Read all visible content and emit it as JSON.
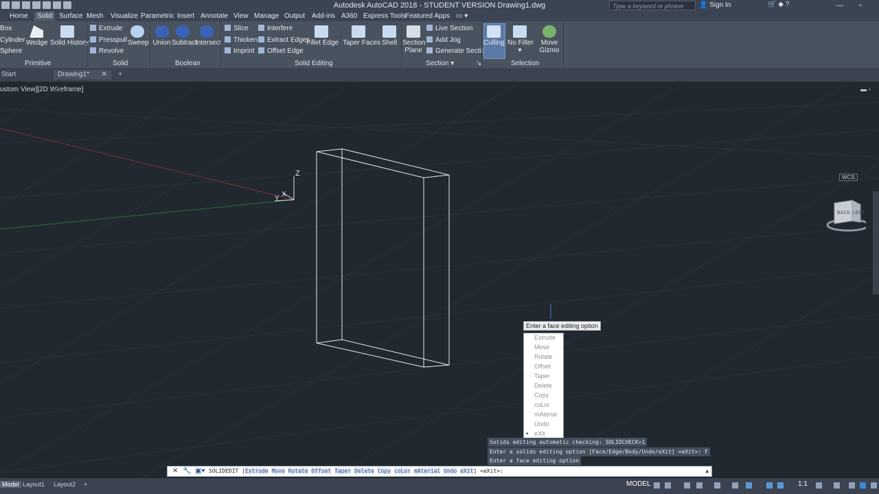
{
  "titlebar": {
    "title": "Autodesk AutoCAD 2018 - STUDENT VERSION    Drawing1.dwg",
    "search_placeholder": "Type a keyword or phrase",
    "signin": "Sign In"
  },
  "ribbon_tabs": [
    "Home",
    "Solid",
    "Surface",
    "Mesh",
    "Visualize",
    "Parametric",
    "Insert",
    "Annotate",
    "View",
    "Manage",
    "Output",
    "Add-ins",
    "A360",
    "Express Tools",
    "Featured Apps"
  ],
  "active_tab": "Solid",
  "ribbon": {
    "primitive": {
      "label": "Primitive",
      "small": [
        "Box",
        "Cylinder",
        "Sphere"
      ],
      "wedge": "Wedge",
      "solid_history": "Solid History"
    },
    "solid": {
      "label": "Solid",
      "small": [
        "Extrude",
        "Presspull",
        "Revolve"
      ],
      "sweep": "Sweep"
    },
    "boolean": {
      "label": "Boolean",
      "buttons": [
        "Union",
        "Subtract",
        "Intersect"
      ]
    },
    "solid_editing": {
      "label": "Solid Editing",
      "col1": [
        "Slice",
        "Thicken",
        "Imprint"
      ],
      "col2": [
        "Interfere",
        "Extract Edges",
        "Offset Edge"
      ],
      "fillet_edge": "Fillet Edge",
      "taper_faces": "Taper Faces",
      "shell": "Shell"
    },
    "section": {
      "label": "Section",
      "section_plane_1": "Section",
      "section_plane_2": "Plane",
      "small": [
        "Live Section",
        "Add Jog",
        "Generate Section"
      ]
    },
    "selection": {
      "label": "Selection",
      "culling": "Culling",
      "no_filter": "No Filter",
      "move_gizmo_1": "Move",
      "move_gizmo_2": "Gizmo"
    }
  },
  "doc_tabs": {
    "start": "Start",
    "drawing": "Drawing1*"
  },
  "viewport": {
    "label": "ustom View][2D Wireframe]",
    "axis_z": "Z",
    "axis_y": "Y",
    "axis_x": "X",
    "viewcube_back": "BACK",
    "viewcube_left": "LEFT",
    "wcs": "WCS"
  },
  "tooltip": "Enter a face editing option",
  "menu": {
    "items": [
      "Extrude",
      "Move",
      "Rotate",
      "Offset",
      "Taper",
      "Delete",
      "Copy",
      "coLor",
      "mAterial",
      "Undo",
      "eXit"
    ],
    "selected": "eXit"
  },
  "history": [
    "Solids editing automatic checking:  SOLIDCHECK=1",
    "Enter a solids editing option [Face/Edge/Body/Undo/eXit] <eXit>: F",
    "Enter a face editing option"
  ],
  "commandline": {
    "command": "SOLIDEDIT",
    "options": [
      "Extrude",
      "Move",
      "Rotate",
      "Offset",
      "Taper",
      "Delete",
      "Copy",
      "coLor",
      "mAterial",
      "Undo",
      "eXit"
    ],
    "suffix": "<eXit>:"
  },
  "statusbar": {
    "tabs": [
      "Model",
      "Layout1",
      "Layout2"
    ],
    "model_label": "MODEL",
    "scale": "1:1"
  },
  "colors": {
    "viewport_bg": "#212830",
    "ribbon_bg": "#49525f",
    "accent": "#5b7aa6"
  }
}
